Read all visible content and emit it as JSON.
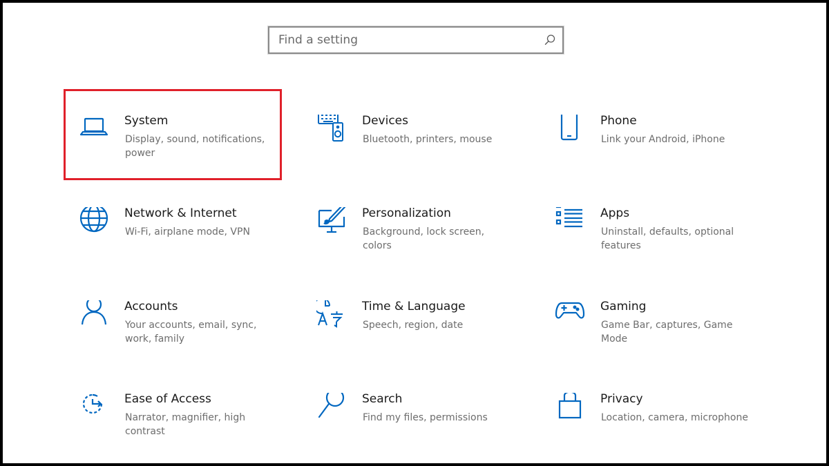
{
  "search": {
    "placeholder": "Find a setting",
    "value": "",
    "icon": "search-icon"
  },
  "accent_color": "#0067c0",
  "highlight_color": "#e0202a",
  "tiles": [
    {
      "title": "System",
      "description": "Display, sound, notifications, power",
      "icon": "laptop-icon"
    },
    {
      "title": "Devices",
      "description": "Bluetooth, printers, mouse",
      "icon": "devices-icon"
    },
    {
      "title": "Phone",
      "description": "Link your Android, iPhone",
      "icon": "phone-icon"
    },
    {
      "title": "Network & Internet",
      "description": "Wi-Fi, airplane mode, VPN",
      "icon": "globe-icon"
    },
    {
      "title": "Personalization",
      "description": "Background, lock screen, colors",
      "icon": "paint-brush-icon"
    },
    {
      "title": "Apps",
      "description": "Uninstall, defaults, optional features",
      "icon": "apps-list-icon"
    },
    {
      "title": "Accounts",
      "description": "Your accounts, email, sync, work, family",
      "icon": "person-icon"
    },
    {
      "title": "Time & Language",
      "description": "Speech, region, date",
      "icon": "time-language-icon"
    },
    {
      "title": "Gaming",
      "description": "Game Bar, captures, Game Mode",
      "icon": "gamepad-icon"
    },
    {
      "title": "Ease of Access",
      "description": "Narrator, magnifier, high contrast",
      "icon": "ease-of-access-icon"
    },
    {
      "title": "Search",
      "description": "Find my files, permissions",
      "icon": "magnifier-icon"
    },
    {
      "title": "Privacy",
      "description": "Location, camera, microphone",
      "icon": "lock-icon"
    }
  ]
}
